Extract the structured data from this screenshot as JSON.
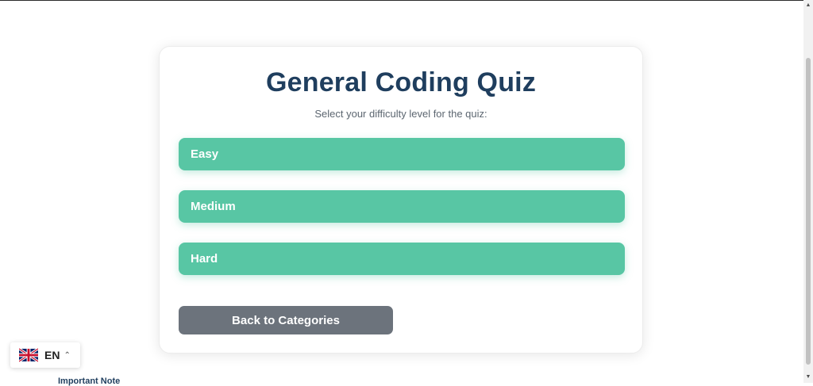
{
  "quiz": {
    "title": "General Coding Quiz",
    "subtitle": "Select your difficulty level for the quiz:",
    "levels": [
      "Easy",
      "Medium",
      "Hard"
    ],
    "back_label": "Back to Categories"
  },
  "language_selector": {
    "code": "EN",
    "flag_icon": "uk-flag-icon",
    "chevron_icon": "chevron-up-icon"
  },
  "footer": {
    "note_label": "Important Note"
  },
  "colors": {
    "title": "#1f3e5e",
    "level_button": "#58c6a4",
    "back_button": "#6c737c"
  }
}
